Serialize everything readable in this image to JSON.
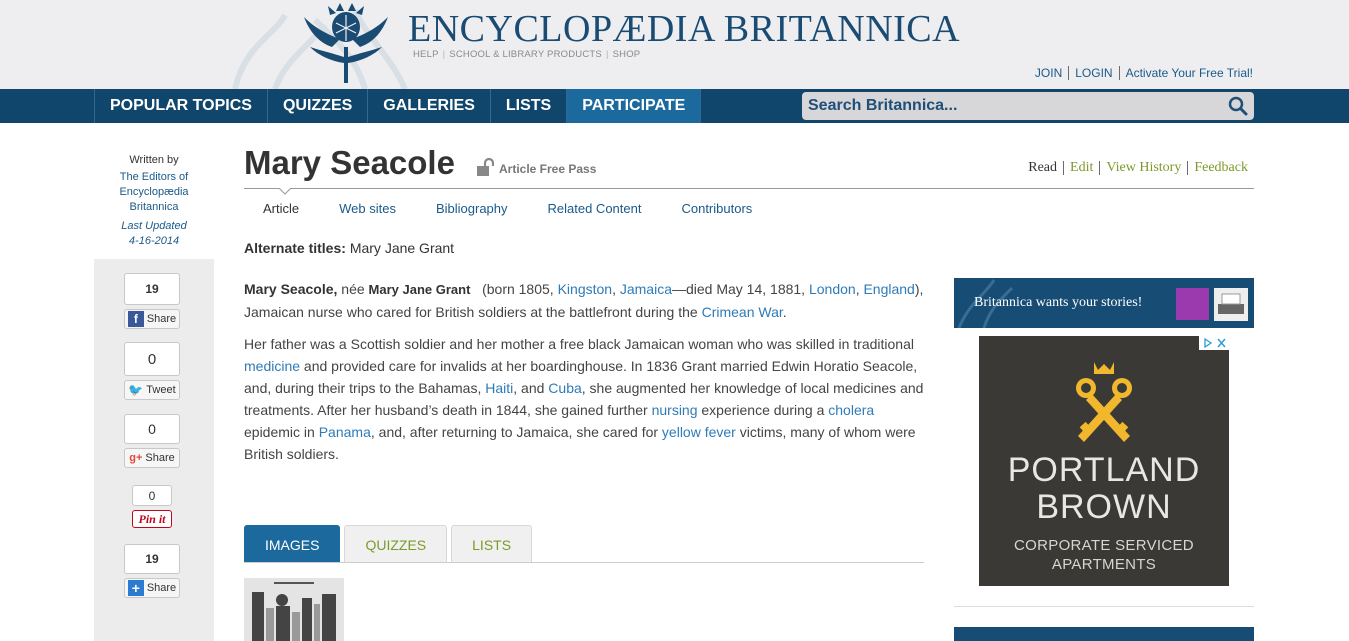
{
  "header": {
    "brand": "ENCYCLOPÆDIA BRITANNICA",
    "links": [
      "HELP",
      "SCHOOL & LIBRARY PRODUCTS",
      "SHOP"
    ],
    "account": [
      "JOIN",
      "LOGIN",
      "Activate Your Free Trial!"
    ]
  },
  "nav": {
    "items": [
      "POPULAR TOPICS",
      "QUIZZES",
      "GALLERIES",
      "LISTS",
      "PARTICIPATE"
    ],
    "active": "PARTICIPATE",
    "search_placeholder": "Search Britannica..."
  },
  "byline": {
    "written_by": "Written by",
    "authors": "The Editors of Encyclopædia Britannica",
    "last_updated_label": "Last Updated",
    "last_updated": "4-16-2014"
  },
  "share": {
    "facebook_count": "19",
    "facebook_label": "Share",
    "twitter_count": "0",
    "twitter_label": "Tweet",
    "google_count": "0",
    "google_label": "Share",
    "pinterest_count": "0",
    "pinterest_label": "Pin it",
    "addthis_count": "19",
    "addthis_label": "Share"
  },
  "article": {
    "title": "Mary Seacole",
    "free_pass": "Article Free Pass",
    "actions": [
      "Read",
      "Edit",
      "View History",
      "Feedback"
    ],
    "subtabs": [
      "Article",
      "Web sites",
      "Bibliography",
      "Related Content",
      "Contributors"
    ],
    "alt_titles_label": "Alternate titles:",
    "alt_titles_value": "Mary Jane Grant",
    "p1": {
      "name": "Mary Seacole,",
      "nee": "née",
      "birth_name": "Mary Jane Grant",
      "born": "(born 1805,",
      "kingston": "Kingston",
      "comma1": ",",
      "jamaica": "Jamaica",
      "died": "—died May 14, 1881,",
      "london": "London",
      "comma2": ",",
      "england": "England",
      "rest": "), Jamaican nurse who cared for British soldiers at the battlefront during the",
      "crimean": "Crimean War",
      "end": "."
    },
    "p2": {
      "t1": "Her father was a Scottish soldier and her mother a free black Jamaican woman who was skilled in traditional",
      "medicine": "medicine",
      "t2": "and provided care for invalids at her boardinghouse. In 1836 Grant married Edwin Horatio Seacole, and, during their trips to the Bahamas,",
      "haiti": "Haiti",
      "t3": ", and",
      "cuba": "Cuba",
      "t4": ", she augmented her knowledge of local medicines and treatments. After her husband’s death in 1844, she gained further",
      "nursing": "nursing",
      "t5": "experience during a",
      "cholera": "cholera",
      "t6": "epidemic in",
      "panama": "Panama",
      "t7": ", and, after returning to Jamaica, she cared for",
      "yellow_fever": "yellow fever",
      "t8": "victims, many of whom were British soldiers."
    },
    "media_tabs": [
      "IMAGES",
      "QUIZZES",
      "LISTS"
    ]
  },
  "sidebar": {
    "promo_text": "Britannica wants your stories!",
    "promo_color": "#9b3aae",
    "ad": {
      "line1": "PORTLAND",
      "line2": "BROWN",
      "sub1": "CORPORATE SERVICED",
      "sub2": "APARTMENTS",
      "key_color": "#f1b82d",
      "bg_color": "#3b3936"
    }
  },
  "colors": {
    "nav_bg": "#10466c",
    "nav_active": "#1c6a9d",
    "link": "#2e7bb8",
    "action_green": "#7d9a2a",
    "brand_blue": "#1a4b73"
  }
}
